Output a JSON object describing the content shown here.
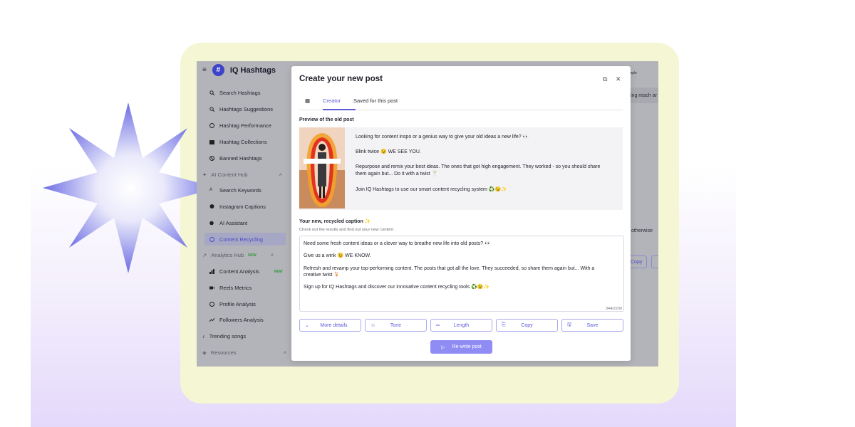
{
  "app": {
    "brand": "IQ Hashtags",
    "sidebar": {
      "items": [
        {
          "label": "Search Hashtags",
          "icon": "search-icon"
        },
        {
          "label": "Hashtags Suggestions",
          "icon": "zoom-icon"
        },
        {
          "label": "Hashtag Performance",
          "icon": "gauge-icon"
        },
        {
          "label": "Hashtag Collections",
          "icon": "folder-icon"
        },
        {
          "label": "Banned Hashtags",
          "icon": "ban-icon"
        }
      ],
      "ai_section": "AI Content Hub",
      "ai_items": [
        {
          "label": "Search Keywords",
          "icon": "keyword-icon"
        },
        {
          "label": "Instagram Captions",
          "icon": "caption-icon"
        },
        {
          "label": "AI Assistant",
          "icon": "assistant-icon"
        },
        {
          "label": "Content Recycling",
          "icon": "recycle-icon"
        }
      ],
      "analytics_section": "Analytics Hub",
      "analytics_badge": "NEW",
      "analytics_items": [
        {
          "label": "Content Analysis",
          "icon": "chart-icon",
          "badge": "NEW"
        },
        {
          "label": "Reels Metrics",
          "icon": "video-icon"
        },
        {
          "label": "Profile Analysis",
          "icon": "profile-icon"
        },
        {
          "label": "Followers Analysis",
          "icon": "trend-icon"
        }
      ],
      "trending": "Trending songs",
      "resources": "Resources"
    },
    "background_fragments": {
      "top_right": "cebook-sample",
      "reach": "ing reach ar",
      "otherwise": "otherwise",
      "copy": "Copy"
    }
  },
  "modal": {
    "title": "Create your new post",
    "tabs": {
      "creator": "Creator",
      "saved": "Saved for this post"
    },
    "preview_label": "Preview of the old post",
    "old_post": {
      "line1": "Looking for content inspo or a genius way to give your old ideas a new life? 👀",
      "line2": "Blink twice 😉 WE SEE YOU.",
      "line3a": "Repurpose and remix your best ideas. The ones that got high engagement. They worked - so you should share",
      "line3b": "them again but... Do it with a twist 🍸",
      "line4": "Join IQ Hashtags to use our smart content recycling system ♻️😉✨"
    },
    "caption_label": "Your new, recycled caption ✨",
    "caption_sub": "Check out the results and find out your new content",
    "new_caption": {
      "line1": "Need some fresh content ideas or a clever way to breathe new life into old posts? 👀",
      "line2": "Give us a wink 😉 WE KNOW.",
      "line3a": "Refresh and revamp your top-performing content. The posts that got all the love. They succeeded, so share them again but... With a",
      "line3b": "creative twist 🍹",
      "line4": "Sign up for IQ Hashtags and discover our innovative content recycling tools ♻️😉✨"
    },
    "counter": "344/2200",
    "buttons": {
      "more": "More details",
      "tone": "Tone",
      "length": "Length",
      "copy": "Copy",
      "save": "Save"
    },
    "rewrite": "Re-write post"
  }
}
